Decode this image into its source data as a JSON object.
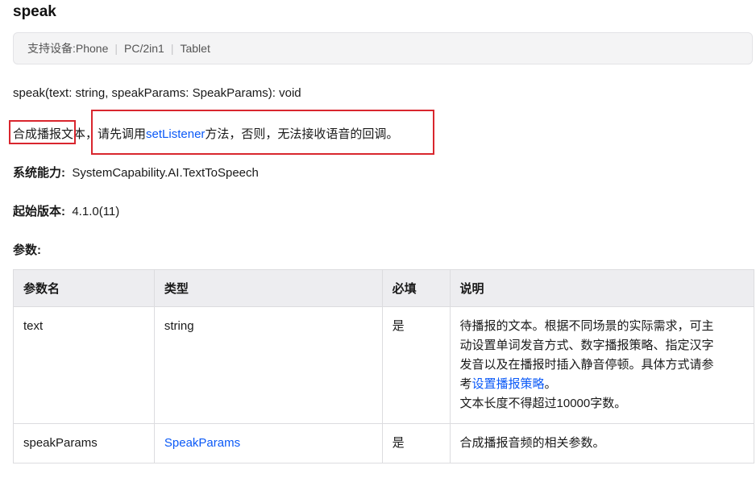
{
  "title": "speak",
  "devices": {
    "label": "支持设备: ",
    "items": [
      "Phone",
      "PC/2in1",
      "Tablet"
    ],
    "separator": "|"
  },
  "signature": "speak(text: string, speakParams: SpeakParams): void",
  "description": {
    "part1": "合成播报文本",
    "comma": "，",
    "part2": "请先调用",
    "link": "setListener",
    "part3": "方法，否则，无法接收语音的回调。"
  },
  "syscap": {
    "label": "系统能力:",
    "value": "SystemCapability.AI.TextToSpeech"
  },
  "since": {
    "label": "起始版本:",
    "value": "4.1.0(11)"
  },
  "params_label": "参数:",
  "table": {
    "headers": [
      "参数名",
      "类型",
      "必填",
      "说明"
    ],
    "rows": [
      {
        "name": "text",
        "type": "string",
        "required": "是",
        "desc_line1": "待播报的文本。根据不同场景的实际需求，可主",
        "desc_line2": "动设置单词发音方式、数字播报策略、指定汉字",
        "desc_line3": "发音以及在播报时插入静音停顿。具体方式请参",
        "desc_line4_pre": "考",
        "desc_line4_link": "设置播报策略",
        "desc_line4_post": "。",
        "desc_line5": "文本长度不得超过10000字数。"
      },
      {
        "name": "speakParams",
        "type": "SpeakParams",
        "required": "是",
        "desc": "合成播报音频的相关参数。"
      }
    ]
  },
  "colors": {
    "link": "#0a59f7",
    "highlight_box": "#d9262e"
  }
}
